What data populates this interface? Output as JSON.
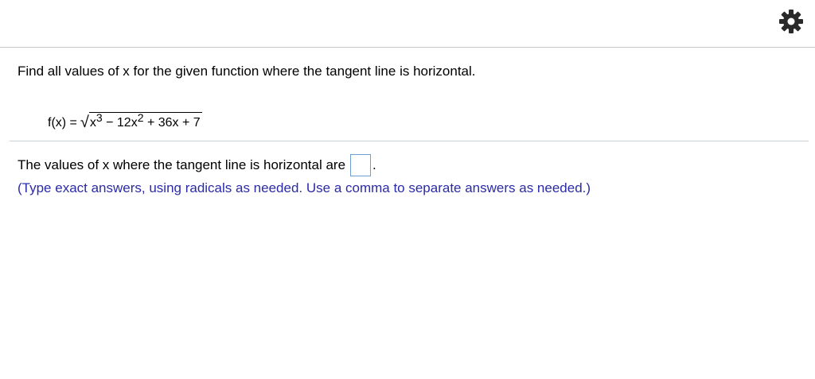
{
  "header": {
    "settings_icon": "gear-icon"
  },
  "question": {
    "prompt": "Find all values of x for the given function where the tangent line is horizontal.",
    "function_lhs": "f(x) =",
    "radicand_x": "x",
    "exp3": "3",
    "term2": " − 12x",
    "exp2": "2",
    "term3": " + 36x + 7"
  },
  "answer": {
    "label": "The values of x where the tangent line is horizontal are",
    "period": ".",
    "hint": "(Type exact answers, using radicals as needed. Use a comma to separate answers as needed.)"
  },
  "colors": {
    "hint": "#2b2ba8",
    "answer_box_border": "#6b9fd6",
    "gear": "#2a2a2a"
  }
}
